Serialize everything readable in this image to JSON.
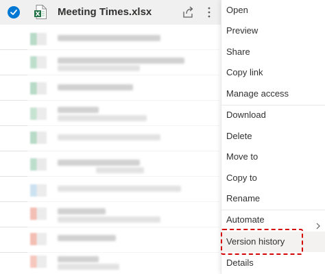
{
  "file": {
    "name": "Meeting Times.xlsx",
    "icons": {
      "check": "check-circle-icon",
      "excel": "excel-file-icon",
      "share": "share-icon",
      "more": "more-vertical-icon"
    }
  },
  "colors": {
    "accent": "#0078d4",
    "excel_green": "#217346",
    "highlight_outline": "#d40000"
  },
  "menu": {
    "items": [
      {
        "label": "Open",
        "has_submenu": true
      },
      {
        "label": "Preview"
      },
      {
        "label": "Share"
      },
      {
        "label": "Copy link"
      },
      {
        "label": "Manage access"
      },
      {
        "label": "Download"
      },
      {
        "label": "Delete"
      },
      {
        "label": "Move to"
      },
      {
        "label": "Copy to"
      },
      {
        "label": "Rename"
      },
      {
        "label": "Automate",
        "has_submenu": true
      },
      {
        "label": "Version history",
        "highlighted": true
      },
      {
        "label": "Details"
      }
    ]
  }
}
